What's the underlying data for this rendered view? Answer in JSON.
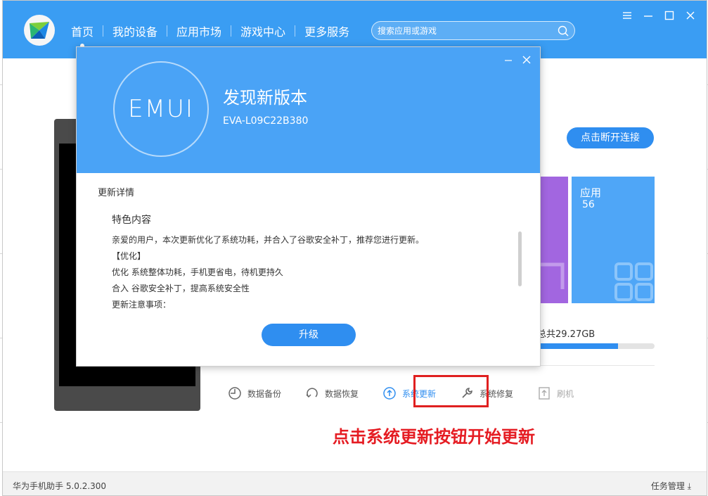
{
  "nav": {
    "items": [
      "首页",
      "我的设备",
      "应用市场",
      "游戏中心",
      "更多服务"
    ],
    "search_placeholder": "搜索应用或游戏"
  },
  "device": {
    "disconnect_label": "点击断开连接",
    "apps_tile": {
      "label": "应用",
      "count": "56"
    },
    "storage_text": "总共29.27GB",
    "storage_used_fraction": 0.69
  },
  "tools": {
    "backup": "数据备份",
    "restore": "数据恢复",
    "update": "系统更新",
    "repair": "系统修复",
    "flash": "刷机"
  },
  "annotation": "点击系统更新按钮开始更新",
  "status": {
    "version": "华为手机助手 5.0.2.300",
    "task_manager": "任务管理"
  },
  "dialog": {
    "logo_text": "EMUI",
    "title": "发现新版本",
    "build": "EVA-L09C22B380",
    "details_label": "更新详情",
    "section_heading": "特色内容",
    "lines": [
      "亲爱的用户，本次更新优化了系统功耗，并合入了谷歌安全补丁，推荐您进行更新。",
      "【优化】",
      "优化 系统整体功耗，手机更省电，待机更持久",
      "合入 谷歌安全补丁，提高系统安全性",
      "更新注意事项："
    ],
    "upgrade_label": "升级"
  },
  "colors": {
    "titlebar": "#3a9df3",
    "dialog_header": "#4aa3f6",
    "button_blue": "#2f8ef0",
    "annotation_red": "#e51c23"
  }
}
